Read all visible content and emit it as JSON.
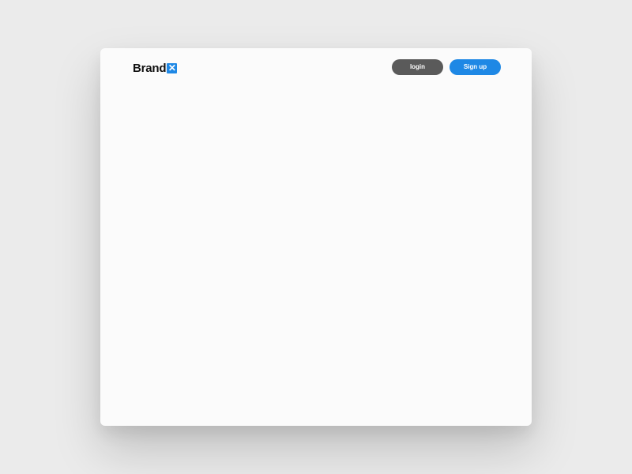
{
  "header": {
    "brand_text": "Brand",
    "brand_mark": "✕",
    "login_label": "login",
    "signup_label": "Sign up"
  },
  "colors": {
    "accent": "#1e88e5",
    "login_button": "#5a5a5a",
    "window_bg": "#fbfbfb",
    "page_bg": "#ebebeb"
  }
}
